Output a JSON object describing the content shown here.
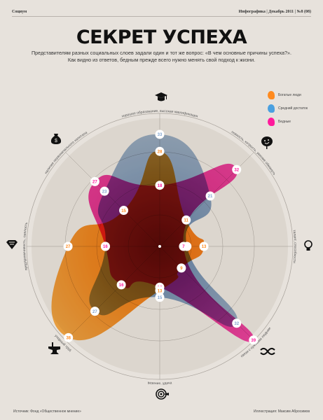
{
  "header": {
    "section": "Социум",
    "issue": "Инфографика | Декабрь 2011 | №8 (08)"
  },
  "title": "СЕКРЕТ УСПЕХА",
  "subtitle": [
    "Представителям разных социальных слоев задали один и тот же вопрос: «В чем основные причины успеха?».",
    "Как видно из ответов, бедным прежде всего нужно менять свой подход к жизни."
  ],
  "legend": [
    {
      "label": "Богатые люди",
      "color": "#ff8a1e"
    },
    {
      "label": "Средний достаток",
      "color": "#4aa0e0"
    },
    {
      "label": "Бедные",
      "color": "#ff1a9c"
    }
  ],
  "icons": [
    "graduation-cap-icon",
    "smiling-mask-icon",
    "light-bulb-icon",
    "knot-icon",
    "target-icon",
    "anvil-icon",
    "superman-icon",
    "money-bag-icon"
  ],
  "chart_data": {
    "type": "radar",
    "title": "СЕКРЕТ УСПЕХА",
    "axes": [
      "хорошее образование, высокая квалификация",
      "ловкость, хитрость, умение обмануть",
      "талант, способности",
      "связи с нужными людьми",
      "везение, удача",
      "упорный труд",
      "предприимчивость, смелость",
      "наличие первоначального капитала"
    ],
    "series": [
      {
        "name": "Средний достаток",
        "color": "#7fa3cf",
        "values": [
          33,
          21,
          8,
          32,
          15,
          27,
          16,
          23
        ]
      },
      {
        "name": "Бедные",
        "color": "#ff1a9c",
        "values": [
          18,
          32,
          7,
          39,
          12,
          16,
          16,
          27
        ]
      },
      {
        "name": "Богатые люди",
        "color": "#ff8a1e",
        "values": [
          28,
          11,
          13,
          9,
          13,
          38,
          27,
          15
        ]
      }
    ],
    "unit": "%"
  },
  "footer": {
    "source": "Источник: Фонд «Общественное мнение»",
    "credit": "Иллюстрация: Максим Абросимов"
  }
}
